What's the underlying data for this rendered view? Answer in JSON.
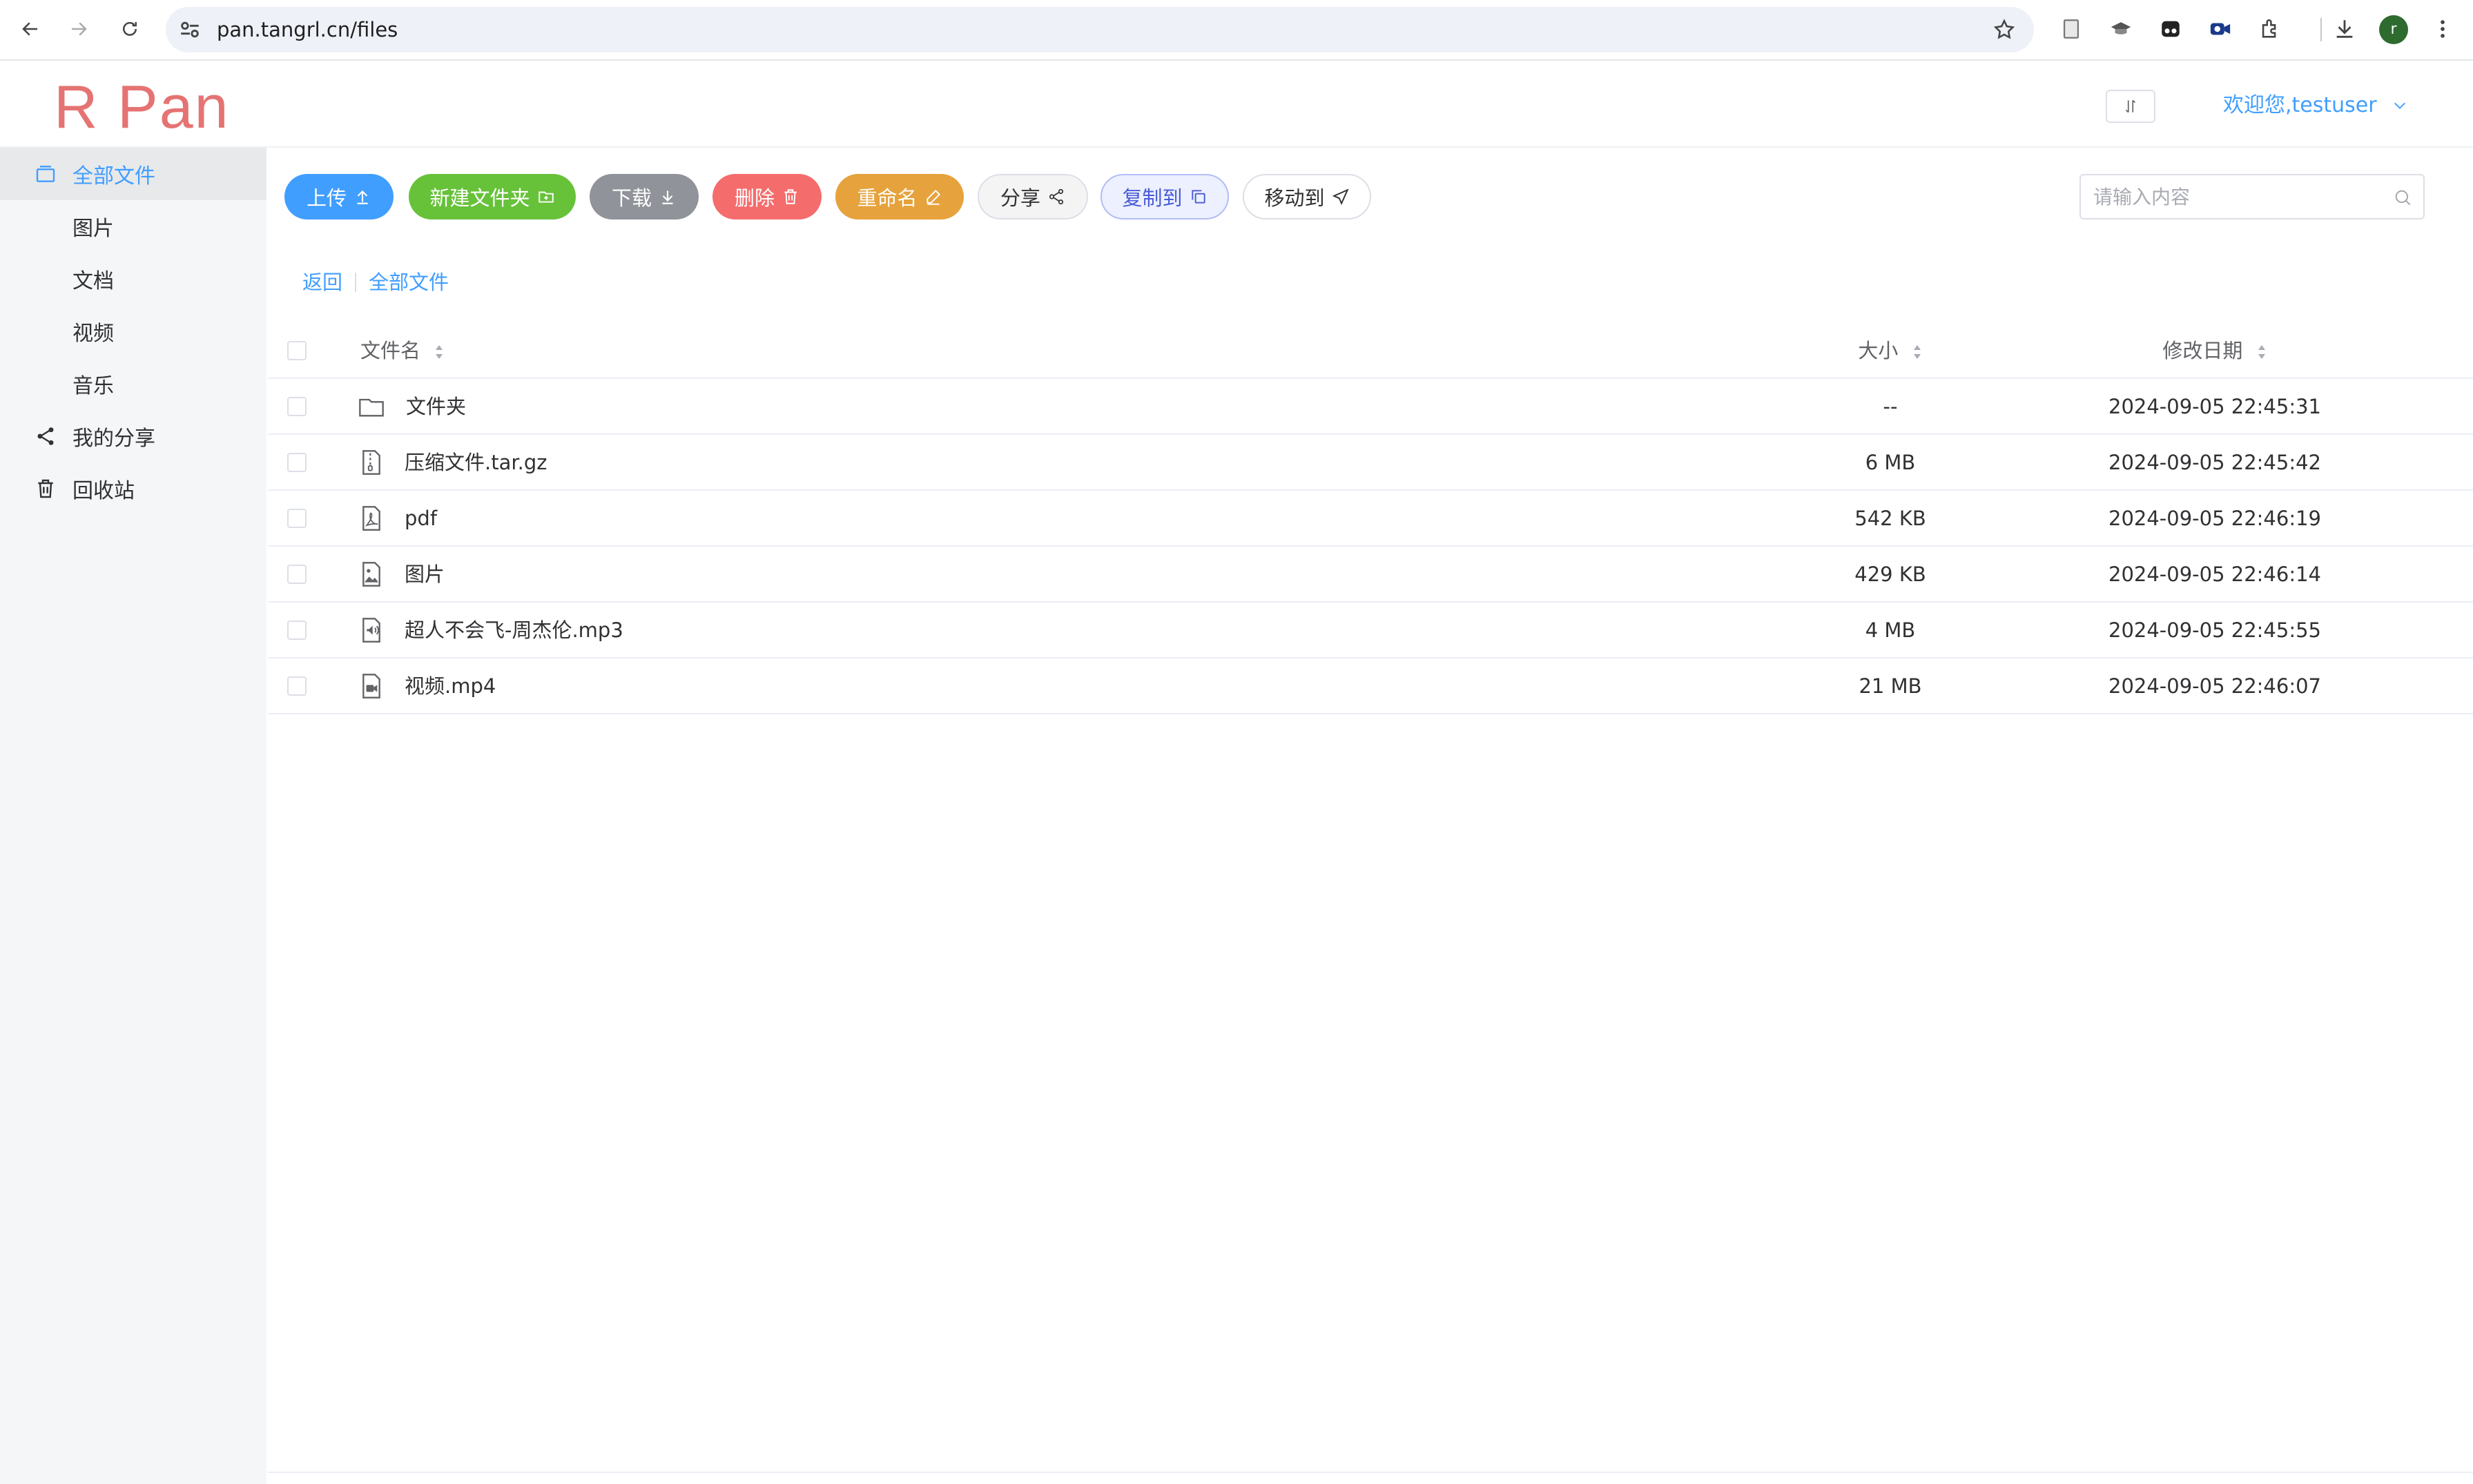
{
  "browser": {
    "url": "pan.tangrl.cn/files",
    "profile_initial": "r"
  },
  "header": {
    "logo": "R Pan",
    "welcome": "欢迎您,testuser"
  },
  "sidebar": {
    "items": [
      {
        "label": "全部文件"
      },
      {
        "label": "图片"
      },
      {
        "label": "文档"
      },
      {
        "label": "视频"
      },
      {
        "label": "音乐"
      },
      {
        "label": "我的分享"
      },
      {
        "label": "回收站"
      }
    ]
  },
  "toolbar": {
    "upload": "上传",
    "new_folder": "新建文件夹",
    "download": "下载",
    "delete": "删除",
    "rename": "重命名",
    "share": "分享",
    "copy_to": "复制到",
    "move_to": "移动到",
    "search_placeholder": "请输入内容"
  },
  "breadcrumb": {
    "back": "返回",
    "current": "全部文件"
  },
  "table": {
    "headers": {
      "name": "文件名",
      "size": "大小",
      "date": "修改日期"
    },
    "rows": [
      {
        "name": "文件夹",
        "size": "--",
        "date": "2024-09-05 22:45:31",
        "icon": "folder-icon"
      },
      {
        "name": "压缩文件.tar.gz",
        "size": "6 MB",
        "date": "2024-09-05 22:45:42",
        "icon": "archive-file-icon"
      },
      {
        "name": "pdf",
        "size": "542 KB",
        "date": "2024-09-05 22:46:19",
        "icon": "pdf-file-icon"
      },
      {
        "name": "图片",
        "size": "429 KB",
        "date": "2024-09-05 22:46:14",
        "icon": "image-file-icon"
      },
      {
        "name": "超人不会飞-周杰伦.mp3",
        "size": "4 MB",
        "date": "2024-09-05 22:45:55",
        "icon": "audio-file-icon"
      },
      {
        "name": "视频.mp4",
        "size": "21 MB",
        "date": "2024-09-05 22:46:07",
        "icon": "video-file-icon"
      }
    ]
  },
  "colors": {
    "primary": "#409eff",
    "success": "#67c23a",
    "info": "#909399",
    "danger": "#f56c6c",
    "warning": "#e6a23c",
    "logo": "#e57373"
  }
}
